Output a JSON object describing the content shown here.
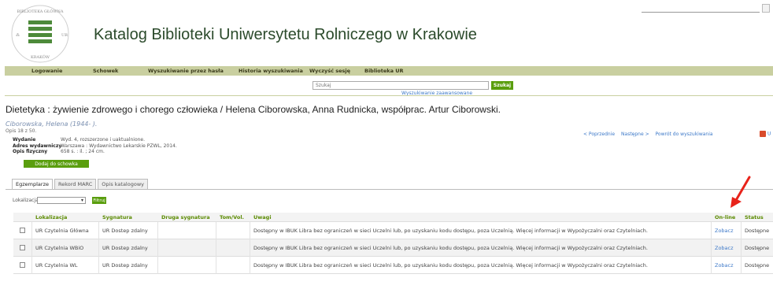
{
  "header": {
    "logo_icon": "university-seal-icon",
    "logo_text": "BIBLIOTEKA GŁÓWNA UR KRAKÓW",
    "title": "Katalog Biblioteki Uniwersytetu Rolniczego w Krakowie"
  },
  "nav": {
    "items": [
      {
        "label": "Logowanie"
      },
      {
        "label": "Schowek"
      },
      {
        "label": "Wyszukiwanie przez hasła"
      },
      {
        "label": "Historia wyszukiwania"
      },
      {
        "label": "Wyczyść sesję"
      },
      {
        "label": "Biblioteka UR"
      }
    ]
  },
  "search": {
    "placeholder": "Szukaj",
    "button_label": "Szukaj",
    "advanced_link": "Wyszukiwanie zaawansowane"
  },
  "record": {
    "title": "Dietetyka : żywienie zdrowego i chorego człowieka / Helena Ciborowska, Anna Rudnicka, współprac. Artur Ciborowski.",
    "author": "Ciborowska, Helena (1944- ).",
    "position": "Opis 18 z 50.",
    "nav": {
      "prev": "< Poprzednie",
      "next": "Następne >",
      "back": "Powrót do wyszukiwania"
    },
    "share_label": "U",
    "meta": [
      {
        "label": "Wydanie",
        "value": "Wyd. 4, rozszerzone i uaktualnione."
      },
      {
        "label": "Adres wydawniczy",
        "value": "Warszawa : Wydawnictwo Lekarskie PZWL, 2014."
      },
      {
        "label": "Opis fizyczny",
        "value": "658 s. : il. ; 24 cm."
      }
    ],
    "add_button": "Dodaj do schowka"
  },
  "tabs": [
    {
      "label": "Egzemplarze",
      "active": true
    },
    {
      "label": "Rekord MARC",
      "active": false
    },
    {
      "label": "Opis katalogowy",
      "active": false
    }
  ],
  "filter": {
    "label": "Lokalizacja",
    "value": "",
    "button": "Filtruj"
  },
  "table": {
    "headers": {
      "lokalizacja": "Lokalizacja",
      "sygnatura": "Sygnatura",
      "druga": "Druga sygnatura",
      "tom": "Tom/Vol.",
      "uwagi": "Uwagi",
      "online": "On-line",
      "status": "Status"
    },
    "rows": [
      {
        "lokalizacja": "UR Czytelnia Główna",
        "sygnatura": "UR Dostep zdalny",
        "druga": "",
        "tom": "",
        "uwagi": "Dostępny w IBUK Libra bez ograniczeń w sieci Uczelni lub, po uzyskaniu kodu dostępu, poza Uczelnią. Więcej informacji w Wypożyczalni oraz Czytelniach.",
        "online": "Zobacz",
        "status": "Dostępne"
      },
      {
        "lokalizacja": "UR Czytelnia WBiO",
        "sygnatura": "UR Dostep zdalny",
        "druga": "",
        "tom": "",
        "uwagi": "Dostępny w IBUK Libra bez ograniczeń w sieci Uczelni lub, po uzyskaniu kodu dostępu, poza Uczelnią. Więcej informacji w Wypożyczalni oraz Czytelniach.",
        "online": "Zobacz",
        "status": "Dostępne"
      },
      {
        "lokalizacja": "UR Czytelnia WL",
        "sygnatura": "UR Dostep zdalny",
        "druga": "",
        "tom": "",
        "uwagi": "Dostępny w IBUK Libra bez ograniczeń w sieci Uczelni lub, po uzyskaniu kodu dostępu, poza Uczelnią. Więcej informacji w Wypożyczalni oraz Czytelniach.",
        "online": "Zobacz",
        "status": "Dostępne"
      }
    ]
  },
  "annotation": {
    "icon": "red-arrow-icon",
    "color": "#e8231a"
  },
  "colors": {
    "accent_green": "#5a9e0e",
    "nav_bg": "#c9cfa0",
    "link_blue": "#3c78c8",
    "header_green": "#5a8a00"
  }
}
